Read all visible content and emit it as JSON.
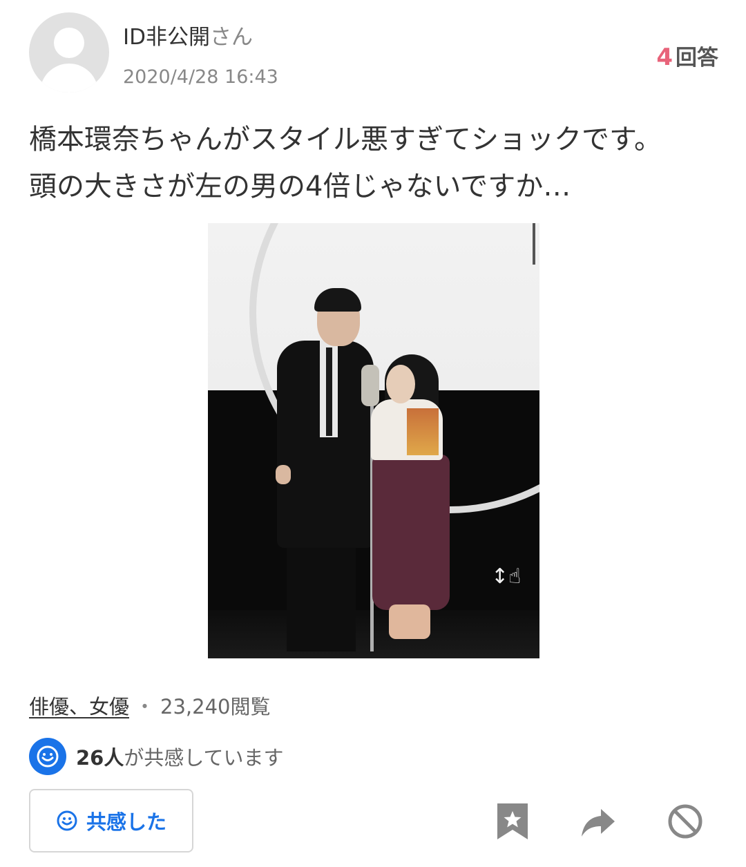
{
  "question": {
    "user_name": "ID非公開",
    "user_suffix": "さん",
    "posted_at": "2020/4/28 16:43",
    "answer_count": "4",
    "answer_count_label": "回答",
    "body_lines": [
      "橋本環奈ちゃんがスタイル悪すぎてショックです。",
      "頭の大きさが左の男の4倍じゃないですか…"
    ],
    "image_overlay_glyph": "↕☝"
  },
  "meta": {
    "category": "俳優、女優",
    "separator": "・",
    "view_count": "23,240閲覧"
  },
  "empathy": {
    "count": "26人",
    "text": "が共感しています",
    "button_label": "共感した"
  },
  "icons": {
    "avatar": "default-user-avatar",
    "empathy_badge": "smile-icon",
    "button_icon": "smile-outline-icon",
    "bookmark": "bookmark-star-icon",
    "share": "share-arrow-icon",
    "block": "block-icon"
  },
  "colors": {
    "accent_blue": "#1a73e8",
    "answer_count_pink": "#e8637a",
    "icon_gray": "#888888"
  }
}
